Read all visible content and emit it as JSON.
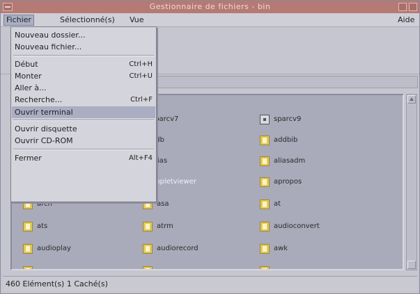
{
  "window": {
    "title": "Gestionnaire de fichiers - bin"
  },
  "menubar": {
    "file": "Fichier",
    "selected": "Sélectionné(s)",
    "view": "Vue",
    "help": "Aide"
  },
  "file_menu": {
    "items": [
      {
        "label": "Nouveau dossier...",
        "shortcut": ""
      },
      {
        "label": "Nouveau fichier...",
        "shortcut": ""
      },
      {
        "label": "Début",
        "shortcut": "Ctrl+H"
      },
      {
        "label": "Monter",
        "shortcut": "Ctrl+U"
      },
      {
        "label": "Aller à...",
        "shortcut": ""
      },
      {
        "label": "Recherche...",
        "shortcut": "Ctrl+F"
      },
      {
        "label": "Ouvrir terminal",
        "shortcut": ""
      },
      {
        "label": "Ouvrir disquette",
        "shortcut": ""
      },
      {
        "label": "Ouvrir CD-ROM",
        "shortcut": ""
      },
      {
        "label": "Fermer",
        "shortcut": "Alt+F4"
      }
    ],
    "highlighted_index": 6
  },
  "files": [
    {
      "name": "sparcv7",
      "icon": "folder-icon"
    },
    {
      "name": "sparcv9",
      "icon": "folder-selected-icon"
    },
    {
      "name": "adb",
      "icon": "file-icon"
    },
    {
      "name": "addbib",
      "icon": "file-icon"
    },
    {
      "name": "alias",
      "icon": "file-icon"
    },
    {
      "name": "aliasadm",
      "icon": "file-icon"
    },
    {
      "name": "appletviewer",
      "icon": "file-icon"
    },
    {
      "name": "apropos",
      "icon": "file-icon"
    },
    {
      "name": "arch",
      "icon": "file-icon"
    },
    {
      "name": "asa",
      "icon": "file-icon"
    },
    {
      "name": "at",
      "icon": "file-icon"
    },
    {
      "name": "ats",
      "icon": "file-icon"
    },
    {
      "name": "atrm",
      "icon": "file-icon"
    },
    {
      "name": "audioconvert",
      "icon": "file-icon"
    },
    {
      "name": "audioplay",
      "icon": "file-icon"
    },
    {
      "name": "audiorecord",
      "icon": "file-icon"
    },
    {
      "name": "awk",
      "icon": "file-icon"
    }
  ],
  "status": {
    "text": "460 Elément(s) 1 Caché(s)"
  },
  "colors": {
    "titlebar": "#b57a74",
    "menu_highlight": "#a9aec2",
    "pane_bg": "#a9aaba",
    "icon_yellow": "#e3c85a"
  }
}
